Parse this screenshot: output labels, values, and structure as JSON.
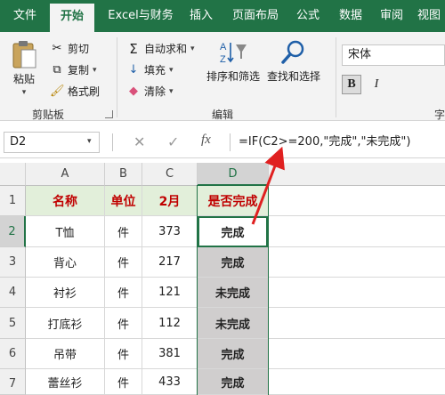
{
  "tabs": [
    "文件",
    "开始",
    "Excel与财务",
    "插入",
    "页面布局",
    "公式",
    "数据",
    "审阅",
    "视图"
  ],
  "clipboard": {
    "paste": "粘贴",
    "cut": "剪切",
    "copy": "复制",
    "format_painter": "格式刷",
    "group_label": "剪贴板"
  },
  "editing": {
    "autosum": "自动求和",
    "fill": "填充",
    "clear": "清除",
    "sort_filter": "排序和筛选",
    "find_select": "查找和选择",
    "group_label": "编辑"
  },
  "font": {
    "name": "宋体",
    "bold": "B",
    "group_label_partial": "字"
  },
  "formula_bar": {
    "name_box": "D2",
    "cancel": "✕",
    "enter": "✓",
    "fx": "fx",
    "formula": "=IF(C2>=200,\"完成\",\"未完成\")"
  },
  "sheet": {
    "columns": [
      "A",
      "B",
      "C",
      "D"
    ],
    "rows": [
      "1",
      "2",
      "3",
      "4",
      "5",
      "6",
      "7"
    ],
    "header": [
      "名称",
      "单位",
      "2月",
      "是否完成"
    ],
    "data": [
      [
        "T恤",
        "件",
        "373",
        "完成"
      ],
      [
        "背心",
        "件",
        "217",
        "完成"
      ],
      [
        "衬衫",
        "件",
        "121",
        "未完成"
      ],
      [
        "打底衫",
        "件",
        "112",
        "未完成"
      ],
      [
        "吊带",
        "件",
        "381",
        "完成"
      ],
      [
        "蕾丝衫",
        "件",
        "433",
        "完成"
      ]
    ]
  },
  "colors": {
    "accent": "#217346",
    "header_fill": "#e2efda",
    "header_text": "#c00000",
    "result_fill": "#d0cece",
    "arrow": "#e02020"
  }
}
